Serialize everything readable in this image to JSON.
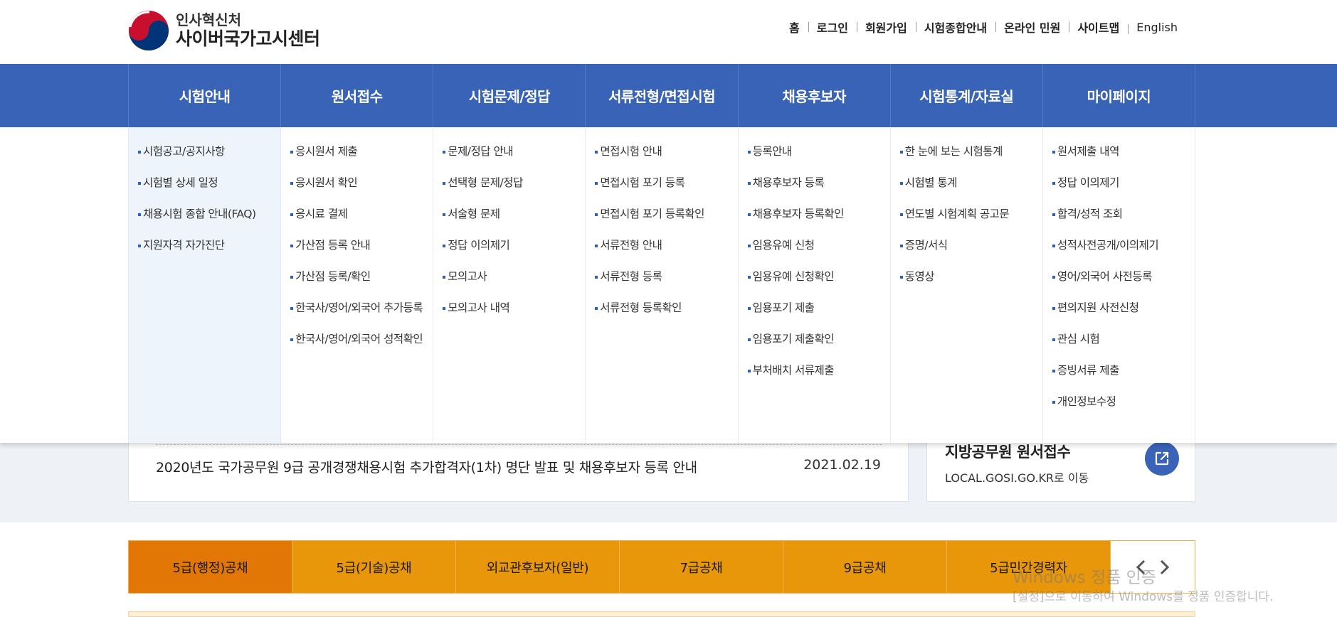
{
  "header": {
    "logo_sub": "인사혁신처",
    "logo_main": "사이버국가고시센터",
    "util_links": [
      "홈",
      "로그인",
      "회원가입",
      "시험종합안내",
      "온라인 민원",
      "사이트맵",
      "English"
    ]
  },
  "gnb": {
    "items": [
      "시험안내",
      "원서접수",
      "시험문제/정답",
      "서류전형/면접시험",
      "채용후보자",
      "시험통계/자료실",
      "마이페이지"
    ]
  },
  "mega": {
    "columns": [
      [
        "시험공고/공지사항",
        "시험별 상세 일정",
        "채용시험 종합 안내(FAQ)",
        "지원자격 자가진단"
      ],
      [
        "응시원서 제출",
        "응시원서 확인",
        "응시료 결제",
        "가산점 등록 안내",
        "가산점 등록/확인",
        "한국사/영어/외국어 추가등록",
        "한국사/영어/외국어 성적확인"
      ],
      [
        "문제/정답 안내",
        "선택형 문제/정답",
        "서술형 문제",
        "정답 이의제기",
        "모의고사",
        "모의고사 내역"
      ],
      [
        "면접시험 안내",
        "면접시험 포기 등록",
        "면접시험 포기 등록확인",
        "서류전형 안내",
        "서류전형 등록",
        "서류전형 등록확인"
      ],
      [
        "등록안내",
        "채용후보자 등록",
        "채용후보자 등록확인",
        "임용유예 신청",
        "임용유예 신청확인",
        "임용포기 제출",
        "임용포기 제출확인",
        "부처배치 서류제출"
      ],
      [
        "한 눈에 보는 시험통계",
        "시험별 통계",
        "연도별 시험계획 공고문",
        "증명/서식",
        "동영상"
      ],
      [
        "원서제출 내역",
        "정답 이의제기",
        "합격/성적 조회",
        "성적사전공개/이의제기",
        "영어/외국어 사전등록",
        "편의지원 사전신청",
        "관심 시험",
        "증빙서류 제출",
        "개인정보수정"
      ]
    ]
  },
  "notice": {
    "title": "2020년도 국가공무원 9급 공개경쟁채용시험 추가합격자(1차) 명단 발표 및 채용후보자 등록 안내",
    "date": "2021.02.19"
  },
  "local": {
    "title": "지방공무원 원서접수",
    "sub": "LOCAL.GOSI.GO.KR로 이동"
  },
  "tabs": {
    "items": [
      "5급(행정)공채",
      "5급(기술)공채",
      "외교관후보자(일반)",
      "7급공채",
      "9급공채",
      "5급민간경력자"
    ]
  },
  "watermark": {
    "line1": "Windows 정품 인증",
    "line2": "[설정]으로 이동하여 Windows를 정품 인증합니다."
  },
  "colors": {
    "nav_blue": "#3863b7",
    "tab_orange": "#e8960a",
    "tab_active": "#e27706"
  }
}
